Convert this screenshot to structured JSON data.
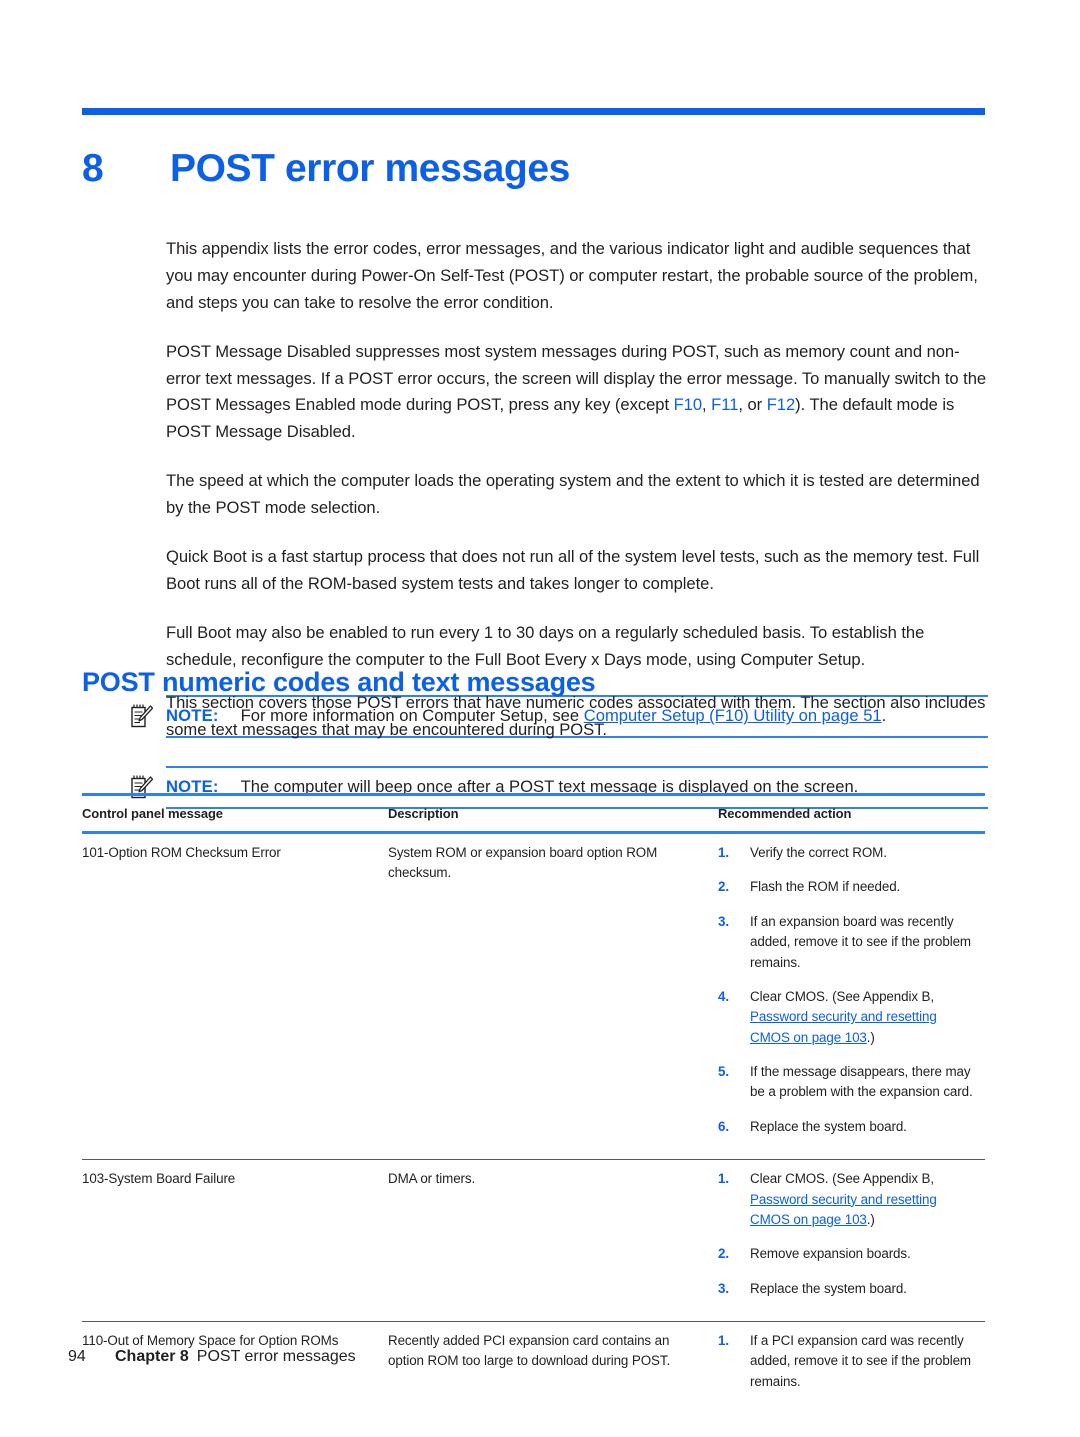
{
  "chapter": {
    "number": "8",
    "title": "POST error messages"
  },
  "intro_paragraphs": [
    "This appendix lists the error codes, error messages, and the various indicator light and audible sequences that you may encounter during Power-On Self-Test (POST) or computer restart, the probable source of the problem, and steps you can take to resolve the error condition."
  ],
  "post_message_paragraph": {
    "part1": "POST Message Disabled suppresses most system messages during POST, such as memory count and non-error text messages. If a POST error occurs, the screen will display the error message. To manually switch to the POST Messages Enabled mode during POST, press any key (except ",
    "key1": "F10",
    "sep1": ", ",
    "key2": "F11",
    "sep2": ", or ",
    "key3": "F12",
    "part2": "). The default mode is POST Message Disabled."
  },
  "more_paragraphs": [
    "The speed at which the computer loads the operating system and the extent to which it is tested are determined by the POST mode selection.",
    "Quick Boot is a fast startup process that does not run all of the system level tests, such as the memory test. Full Boot runs all of the ROM-based system tests and takes longer to complete.",
    "Full Boot may also be enabled to run every 1 to 30 days on a regularly scheduled basis. To establish the schedule, reconfigure the computer to the Full Boot Every x Days mode, using Computer Setup."
  ],
  "note1": {
    "icon": "note-pencil-icon",
    "label": "NOTE:",
    "text_before": "For more information on Computer Setup, see ",
    "link": "Computer Setup (F10) Utility on page 51",
    "text_after": "."
  },
  "section": {
    "heading": "POST numeric codes and text messages",
    "paragraph": "This section covers those POST errors that have numeric codes associated with them. The section also includes some text messages that may be encountered during POST."
  },
  "note2": {
    "icon": "note-pencil-icon",
    "label": "NOTE:",
    "text": "The computer will beep once after a POST text message is displayed on the screen."
  },
  "table": {
    "headers": [
      "Control panel message",
      "Description",
      "Recommended action"
    ],
    "rows": [
      {
        "message": "101-Option ROM Checksum Error",
        "description": "System ROM or expansion board option ROM checksum.",
        "actions": [
          {
            "num": "1.",
            "text": "Verify the correct ROM."
          },
          {
            "num": "2.",
            "text": "Flash the ROM if needed."
          },
          {
            "num": "3.",
            "text": "If an expansion board was recently added, remove it to see if the problem remains."
          },
          {
            "num": "4.",
            "text_before": "Clear CMOS. (See Appendix B, ",
            "link": "Password security and resetting CMOS on page 103",
            "text_after": ".)"
          },
          {
            "num": "5.",
            "text": "If the message disappears, there may be a problem with the expansion card."
          },
          {
            "num": "6.",
            "text": "Replace the system board."
          }
        ]
      },
      {
        "message": "103-System Board Failure",
        "description": "DMA or timers.",
        "actions": [
          {
            "num": "1.",
            "text_before": "Clear CMOS. (See Appendix B, ",
            "link": "Password security and resetting CMOS on page 103",
            "text_after": ".)"
          },
          {
            "num": "2.",
            "text": "Remove expansion boards."
          },
          {
            "num": "3.",
            "text": "Replace the system board."
          }
        ]
      },
      {
        "message": "110-Out of Memory Space for Option ROMs",
        "description": "Recently added PCI expansion card contains an option ROM too large to download during POST.",
        "actions": [
          {
            "num": "1.",
            "text": "If a PCI expansion card was recently added, remove it to see if the problem remains."
          }
        ]
      }
    ]
  },
  "footer": {
    "page_number": "94",
    "chapter_label": "Chapter 8",
    "chapter_title": "POST error messages"
  },
  "colors": {
    "accent_blue": "#0b5fe8",
    "rule_blue": "#2f80f0",
    "text": "#231f20",
    "row_divider": "#58595b"
  }
}
